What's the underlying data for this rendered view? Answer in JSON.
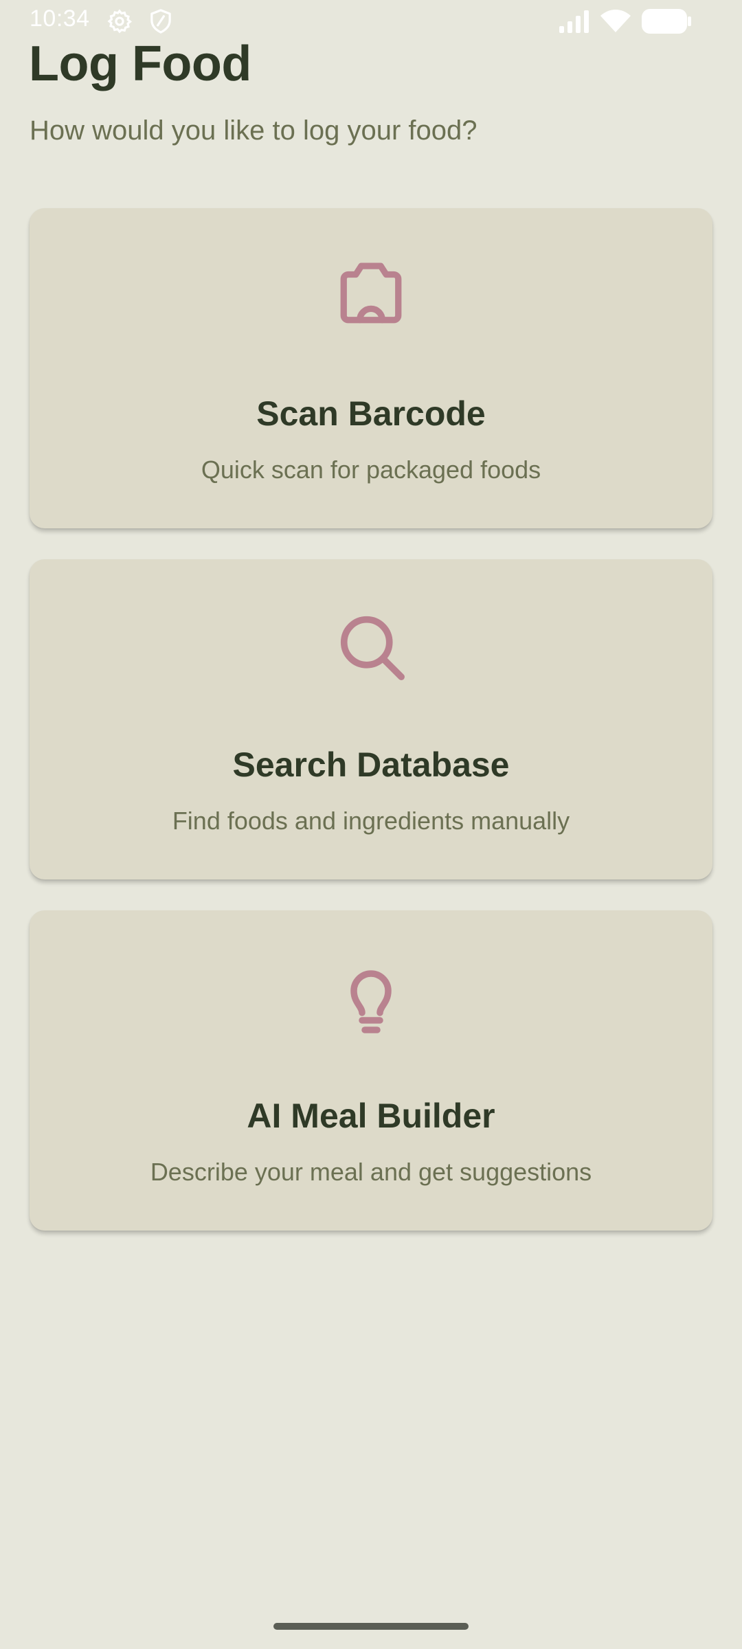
{
  "status_bar": {
    "time": "10:34",
    "icons": [
      "gear-icon",
      "shield-icon",
      "signal-icon",
      "wifi-icon",
      "battery-icon"
    ]
  },
  "page": {
    "title": "Log Food",
    "subtitle": "How would you like to log your food?"
  },
  "options": [
    {
      "title": "Scan Barcode",
      "description": "Quick scan for packaged foods",
      "icon": "camera-icon"
    },
    {
      "title": "Search Database",
      "description": "Find foods and ingredients manually",
      "icon": "search-icon"
    },
    {
      "title": "AI Meal Builder",
      "description": "Describe your meal and get suggestions",
      "icon": "lightbulb-icon"
    }
  ],
  "colors": {
    "background": "#e7e7dc",
    "card": "#dddac9",
    "title_text": "#2f3a27",
    "secondary_text": "#6b7052",
    "accent_icon": "#b9828f"
  }
}
